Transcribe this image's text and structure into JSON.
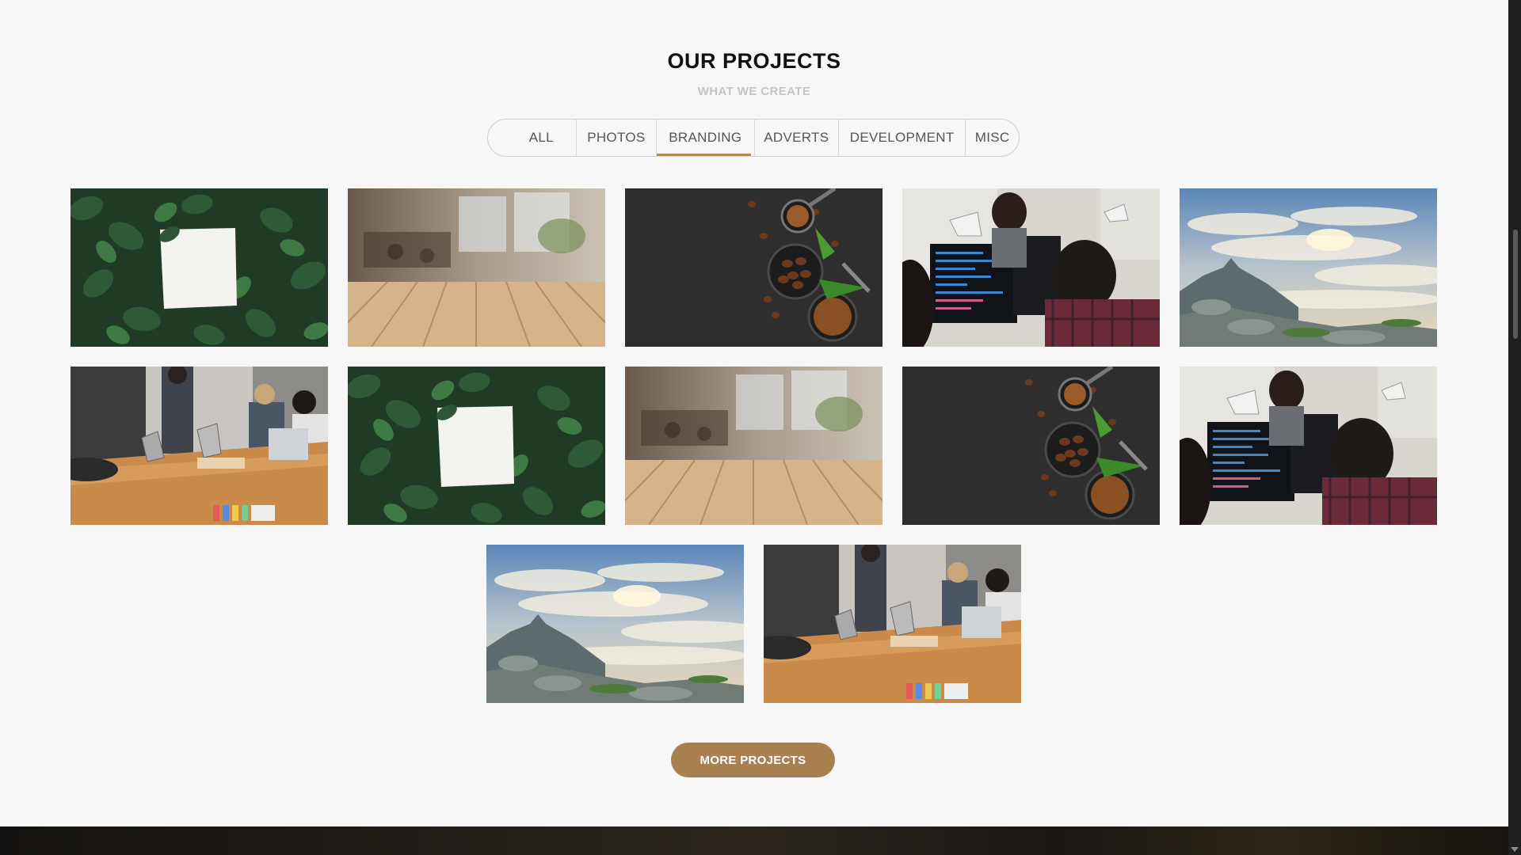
{
  "section": {
    "title": "OUR PROJECTS",
    "subtitle": "WHAT WE CREATE"
  },
  "filters": [
    {
      "label": "ALL",
      "active": false
    },
    {
      "label": "PHOTOS",
      "active": false
    },
    {
      "label": "BRANDING",
      "active": true
    },
    {
      "label": "ADVERTS",
      "active": false
    },
    {
      "label": "DEVELOPMENT",
      "active": false
    },
    {
      "label": "MISC",
      "active": false
    }
  ],
  "gallery": [
    {
      "image": "leaves-paper-photo"
    },
    {
      "image": "cafe-wood-table-photo"
    },
    {
      "image": "coffee-beans-photo"
    },
    {
      "image": "developers-at-desk-photo"
    },
    {
      "image": "mountain-sunset-photo"
    },
    {
      "image": "office-meeting-photo"
    },
    {
      "image": "leaves-paper-photo"
    },
    {
      "image": "cafe-wood-table-photo"
    },
    {
      "image": "coffee-beans-photo"
    },
    {
      "image": "developers-at-desk-photo"
    },
    {
      "image": "mountain-sunset-photo"
    },
    {
      "image": "office-meeting-photo"
    }
  ],
  "more_button": {
    "label": "MORE PROJECTS"
  },
  "colors": {
    "accent": "#b08a5a",
    "button": "#a9804f",
    "background": "#f7f7f7"
  }
}
